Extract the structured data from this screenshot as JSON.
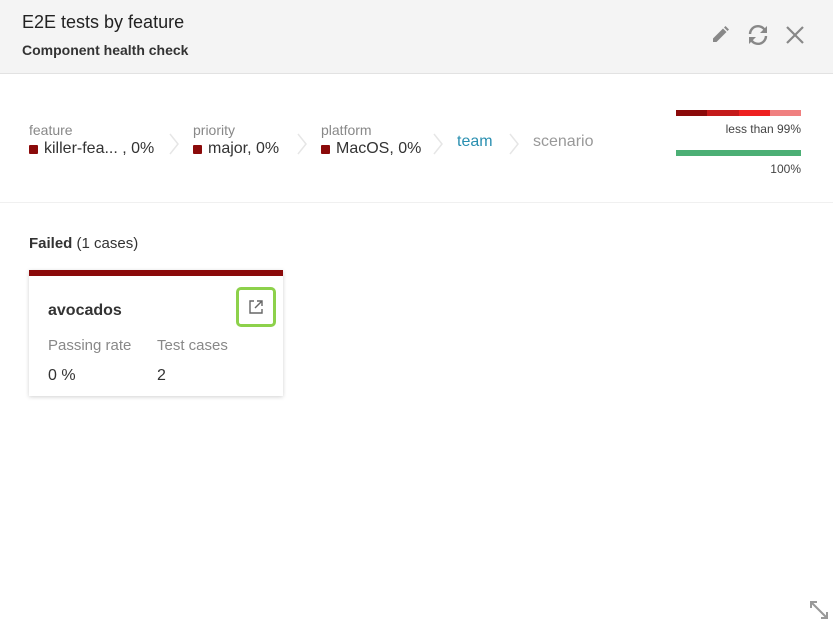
{
  "header": {
    "title": "E2E tests by feature",
    "subtitle": "Component health check",
    "icons": [
      "pencil-icon",
      "refresh-icon",
      "close-icon"
    ]
  },
  "breadcrumbs": {
    "items": [
      {
        "label": "feature",
        "value": "killer-fea... , 0%"
      },
      {
        "label": "priority",
        "value": "major, 0%"
      },
      {
        "label": "platform",
        "value": "MacOS, 0%"
      },
      {
        "label": "team"
      },
      {
        "label": "scenario"
      }
    ]
  },
  "legend": {
    "failing": {
      "label": "less than 99%",
      "colors": [
        "#8b0a0a",
        "#c41a1a",
        "#ee2020",
        "#f08080"
      ]
    },
    "passing": {
      "label": "100%",
      "color": "#4caf75"
    }
  },
  "section": {
    "title": "Failed",
    "count": "(1 cases)"
  },
  "card": {
    "name": "avocados",
    "passing_rate_label": "Passing rate",
    "test_cases_label": "Test cases",
    "passing_rate": "0 %",
    "test_cases": "2",
    "status_color": "#8b0a0a"
  },
  "colors": {
    "accent_link": "#2a8fb0",
    "highlight": "#8dd14b"
  }
}
